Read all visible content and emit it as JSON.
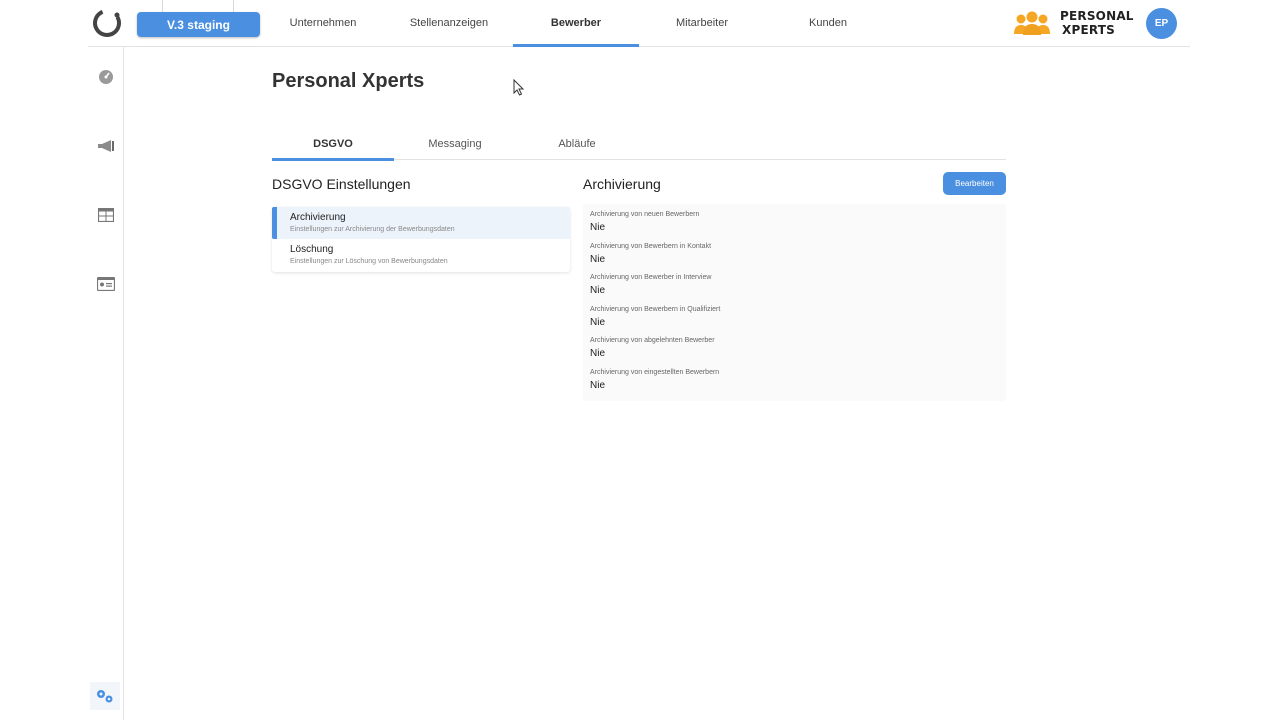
{
  "header": {
    "env_label": "V.3 staging",
    "nav": [
      {
        "label": "Unternehmen",
        "active": false
      },
      {
        "label": "Stellenanzeigen",
        "active": false
      },
      {
        "label": "Bewerber",
        "active": true
      },
      {
        "label": "Mitarbeiter",
        "active": false
      },
      {
        "label": "Kunden",
        "active": false
      }
    ],
    "brand": {
      "line1": "PERSONAL",
      "line2": "XPERTS"
    },
    "avatar_initials": "EP"
  },
  "sidebar": {
    "icons": [
      "dashboard-icon",
      "megaphone-icon",
      "table-icon",
      "id-card-icon"
    ],
    "bottom_icon": "settings-gears-icon"
  },
  "page": {
    "title": "Personal Xperts",
    "tabs": [
      {
        "label": "DSGVO",
        "active": true
      },
      {
        "label": "Messaging",
        "active": false
      },
      {
        "label": "Abläufe",
        "active": false
      }
    ]
  },
  "left": {
    "title": "DSGVO Einstellungen",
    "items": [
      {
        "title": "Archivierung",
        "subtitle": "Einstellungen zur Archivierung der Bewerbungsdaten",
        "active": true
      },
      {
        "title": "Löschung",
        "subtitle": "Einstellungen zur Löschung von Bewerbungsdaten",
        "active": false
      }
    ]
  },
  "right": {
    "title": "Archivierung",
    "edit_label": "Bearbeiten",
    "fields": [
      {
        "label": "Archivierung von neuen Bewerbern",
        "value": "Nie"
      },
      {
        "label": "Archivierung von Bewerbern in Kontakt",
        "value": "Nie"
      },
      {
        "label": "Archivierung von Bewerber in Interview",
        "value": "Nie"
      },
      {
        "label": "Archivierung von Bewerbern in Qualifiziert",
        "value": "Nie"
      },
      {
        "label": "Archivierung von abgelehnten Bewerber",
        "value": "Nie"
      },
      {
        "label": "Archivierung von eingestellten Bewerbern",
        "value": "Nie"
      }
    ]
  },
  "colors": {
    "accent": "#4a8fe0",
    "brand_orange": "#f5a623"
  }
}
